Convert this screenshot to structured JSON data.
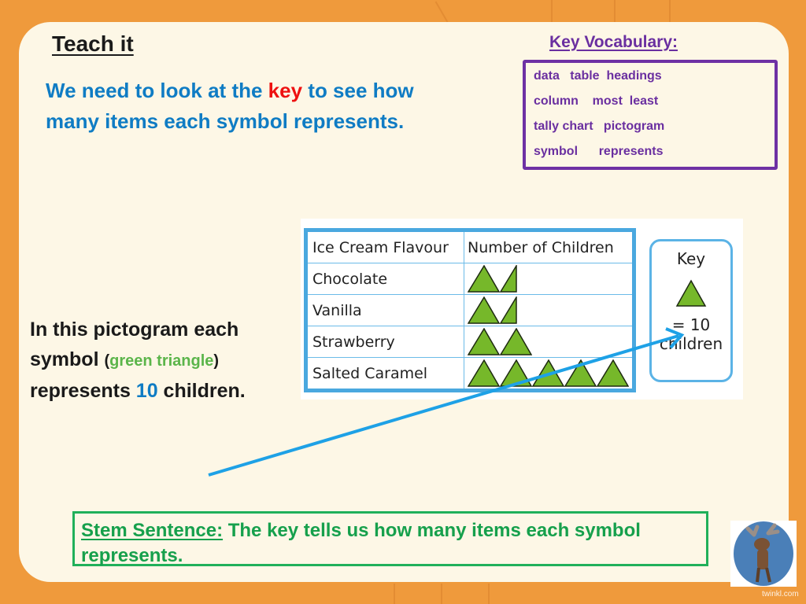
{
  "header": {
    "title": "Teach it",
    "intro_part1": "We need to look at the ",
    "intro_highlight": "key",
    "intro_part2": " to see how many items each symbol represents."
  },
  "vocabulary": {
    "title": "Key Vocabulary:",
    "rows": [
      "data   table  headings",
      "column    most  least",
      "tally chart   pictogram",
      "symbol      represents"
    ]
  },
  "explanation": {
    "part1": "In this pictogram each symbol ",
    "paren_open": "(",
    "green_text": "green triangle",
    "paren_close": ")",
    "part2": " represents ",
    "number": "10",
    "part3": " children."
  },
  "stem_sentence": {
    "label": "Stem Sentence:",
    "text": " The key tells us how many items each symbol represents."
  },
  "brand": "twinkl.com",
  "colors": {
    "triangle_fill": "#76b82a",
    "triangle_stroke": "#1d2a10",
    "arrow": "#1ea1e6"
  },
  "chart_data": {
    "type": "table",
    "title": "",
    "columns": [
      "Ice Cream Flavour",
      "Number of Children"
    ],
    "rows": [
      {
        "category": "Chocolate",
        "symbols": 1.5,
        "value": 15
      },
      {
        "category": "Vanilla",
        "symbols": 1.5,
        "value": 15
      },
      {
        "category": "Strawberry",
        "symbols": 2,
        "value": 20
      },
      {
        "category": "Salted Caramel",
        "symbols": 5,
        "value": 50
      }
    ],
    "key": {
      "title": "Key",
      "symbol": "green triangle",
      "equals": "= 10",
      "unit": "children",
      "symbol_value": 10
    }
  }
}
